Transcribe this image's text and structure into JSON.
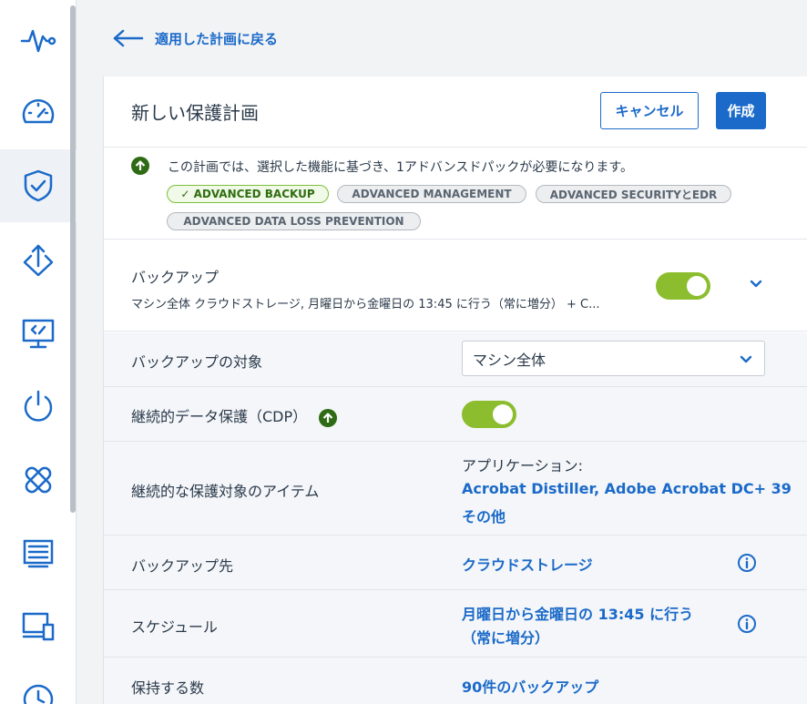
{
  "sidebar": {
    "items": [
      {
        "icon": "activity-icon"
      },
      {
        "icon": "dashboard-gauge-icon"
      },
      {
        "icon": "shield-check-icon",
        "active": true
      },
      {
        "icon": "upload-diamond-icon"
      },
      {
        "icon": "remote-desktop-icon"
      },
      {
        "icon": "power-icon"
      },
      {
        "icon": "bandage-icon"
      },
      {
        "icon": "report-icon"
      },
      {
        "icon": "devices-icon"
      },
      {
        "icon": "clock-icon"
      }
    ]
  },
  "back": {
    "label": "適用した計画に戻る"
  },
  "panel": {
    "title": "新しい保護計画",
    "cancel_label": "キャンセル",
    "create_label": "作成"
  },
  "notice": {
    "text": "この計画では、選択した機能に基づき、1アドバンスドパックが必要になります。",
    "tags": {
      "backup": "✓ ADVANCED BACKUP",
      "management": "ADVANCED MANAGEMENT",
      "security": "ADVANCED SECURITYとEDR",
      "dlp": "ADVANCED DATA LOSS PREVENTION"
    }
  },
  "backup": {
    "title": "バックアップ",
    "summary": "マシン全体 クラウドストレージ, 月曜日から金曜日の 13:45 に行う（常に増分） + C...",
    "enabled": true
  },
  "rows": {
    "target": {
      "label": "バックアップの対象",
      "value": "マシン全体"
    },
    "cdp": {
      "label": "継続的データ保護（CDP）",
      "enabled": true
    },
    "items": {
      "label": "継続的な保護対象のアイテム",
      "heading": "アプリケーション:",
      "value_line1": "Acrobat Distiller, Adobe Acrobat DC+ 39",
      "value_line2": "その他"
    },
    "destination": {
      "label": "バックアップ先",
      "value": "クラウドストレージ"
    },
    "schedule": {
      "label": "スケジュール",
      "value_line1": "月曜日から金曜日の 13:45 に行う",
      "value_line2": "（常に増分）"
    },
    "retention": {
      "label": "保持する数",
      "value": "90件のバックアップ"
    }
  },
  "colors": {
    "accent": "#1b6ac9",
    "toggle_on": "#8cbd2e",
    "upgrade_green": "#2e6b14"
  }
}
